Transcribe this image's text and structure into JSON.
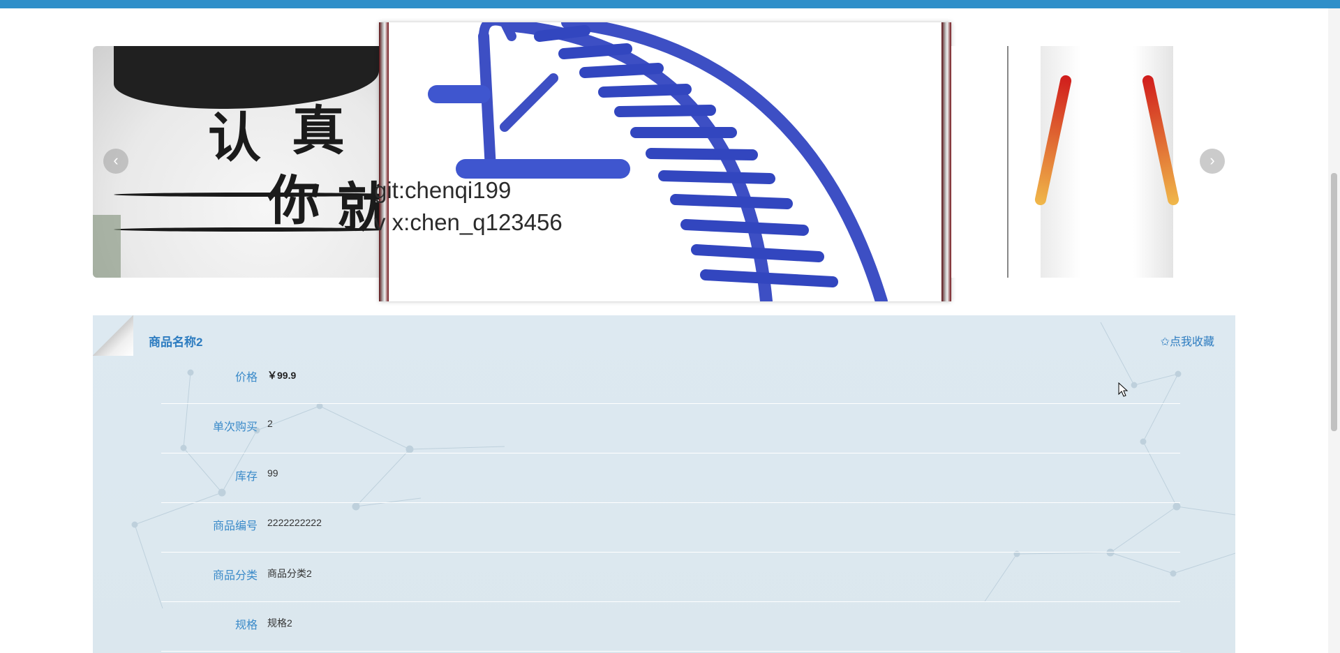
{
  "carousel": {
    "prev_icon": "chevron-left-icon",
    "next_icon": "chevron-right-icon",
    "prev_glyph": "‹",
    "next_glyph": "›",
    "left_slide_text": [
      "认",
      "真",
      "你",
      "就"
    ],
    "watermark_lines": [
      "git:chenqi199",
      "v x:chen_q123456"
    ]
  },
  "product": {
    "name": "商品名称2",
    "favorite_label": "✩点我收藏",
    "fields": [
      {
        "label": "价格",
        "value": "￥99.9"
      },
      {
        "label": "单次购买",
        "value": "2"
      },
      {
        "label": "库存",
        "value": "99"
      },
      {
        "label": "商品编号",
        "value": "2222222222"
      },
      {
        "label": "商品分类",
        "value": "商品分类2"
      },
      {
        "label": "规格",
        "value": "规格2"
      }
    ]
  },
  "colors": {
    "topbar": "#2f8fc9",
    "label": "#3a8ac9",
    "panel_bg": "#dde9f1"
  }
}
